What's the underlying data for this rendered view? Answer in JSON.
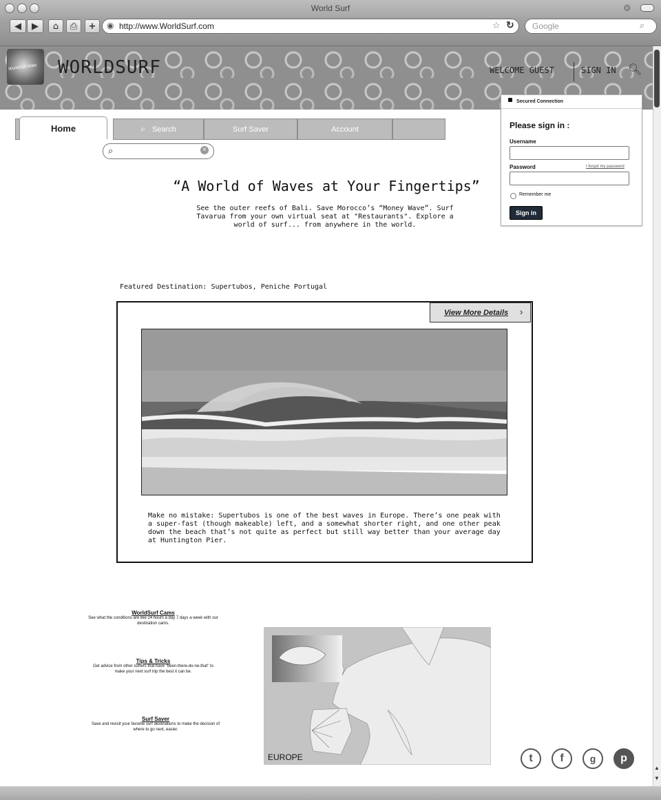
{
  "browser": {
    "title": "World Surf",
    "url": "http://www.WorldSurf.com",
    "search_placeholder": "Google"
  },
  "header": {
    "brand": "WORLDSURF",
    "logo_text": "WorldSurf Atlas",
    "welcome": "WELCOME GUEST",
    "sign_in": "SIGN IN"
  },
  "nav": {
    "tabs": [
      "Home",
      "Search",
      "Surf Saver",
      "Account",
      ""
    ]
  },
  "signin": {
    "secured": "Secured Connection",
    "title": "Please sign in :",
    "username_label": "Username",
    "password_label": "Password",
    "forgot": "I forgot my password",
    "remember": "Remember me",
    "button": "Sign in"
  },
  "hero": {
    "headline": "“A World of Waves at Your Fingertips”",
    "intro": "See the outer reefs of Bali. Save Morocco’s “Money Wave”. Surf Tavarua from your own virtual seat at \"Restaurants\". Explore a world of surf... from anywhere in the world."
  },
  "featured": {
    "label": "Featured Destination: Supertubos, Peniche Portugal",
    "view_more": "View More Details",
    "description": "Make no mistake: Supertubos is one of the best waves in Europe. There’s one peak with a super-fast (though makeable) left, and a somewhat shorter right, and one other peak down the beach that’s not quite as perfect but still way better than your average day at Huntington Pier."
  },
  "info_links": [
    {
      "title": "WorldSurf Cams",
      "desc": "See what the conditions are like 24 hours a day 7 days a week with our destination cams."
    },
    {
      "title": "Tips & Tricks",
      "desc": "Get advice from other surfers that have \"been-there-do-ne-that\" to make your next surf trip the best it can be."
    },
    {
      "title": "Surf Saver",
      "desc": "Save and revisit your favorite surf destinations to make the decision of where to go next, easier."
    }
  ],
  "map": {
    "label": "EUROPE"
  },
  "social": [
    "twitter-icon",
    "facebook-icon",
    "google-plus-icon",
    "pinterest-icon"
  ]
}
